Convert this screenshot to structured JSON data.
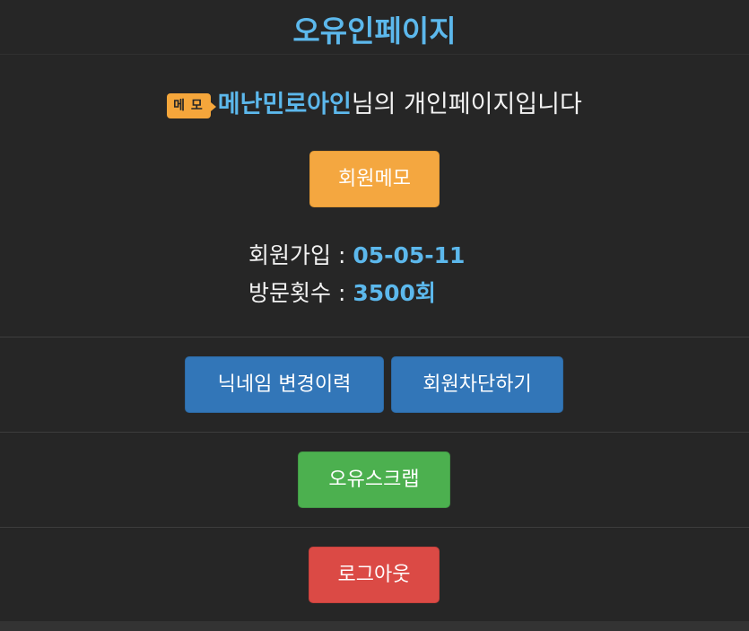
{
  "page": {
    "title": "오유인페이지"
  },
  "intro": {
    "memo_tag": "메 모",
    "username": "메난민로아인",
    "suffix": "님의 개인페이지입니다"
  },
  "buttons": {
    "member_memo": "회원메모",
    "nickname_history": "닉네임 변경이력",
    "block_member": "회원차단하기",
    "ou_scrap": "오유스크랩",
    "logout": "로그아웃"
  },
  "info": {
    "join_label": "회원가입 : ",
    "join_value": "05-05-11",
    "visits_label": "방문횟수 : ",
    "visits_value": "3500회"
  },
  "colors": {
    "background": "#262626",
    "accent_blue": "#5cb8ec",
    "memo_orange": "#f4a740",
    "primary_blue": "#3276b8",
    "success_green": "#4cb04f",
    "danger_red": "#db4a45"
  }
}
